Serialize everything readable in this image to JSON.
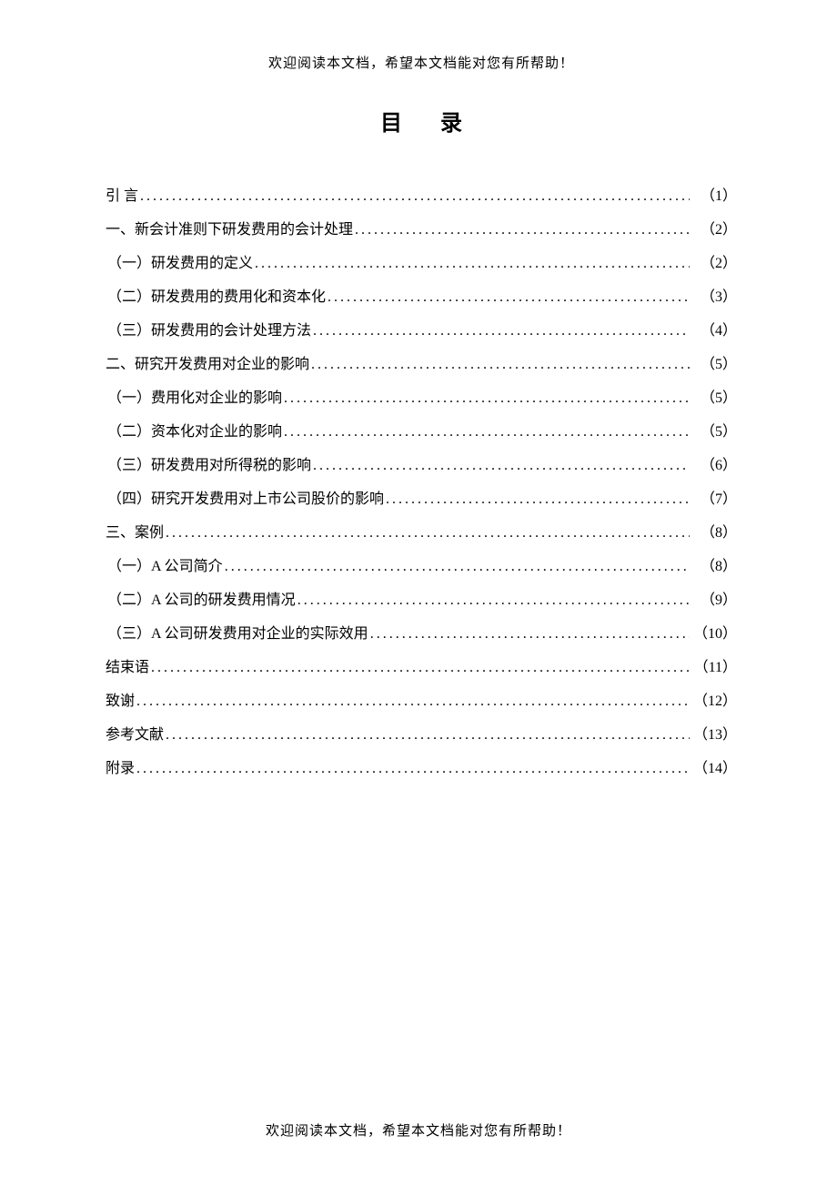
{
  "header_note": "欢迎阅读本文档，希望本文档能对您有所帮助！",
  "footer_note": "欢迎阅读本文档，希望本文档能对您有所帮助！",
  "title": "目  录",
  "toc": [
    {
      "label": "引    言",
      "page": "（1）",
      "level": 0
    },
    {
      "label": "一、新会计准则下研发费用的会计处理",
      "page": "（2）",
      "level": 0
    },
    {
      "label": "（一）研发费用的定义",
      "page": "（2）",
      "level": 1
    },
    {
      "label": "（二）研发费用的费用化和资本化",
      "page": "（3）",
      "level": 1
    },
    {
      "label": "（三）研发费用的会计处理方法",
      "page": "（4）",
      "level": 1
    },
    {
      "label": "二、研究开发费用对企业的影响",
      "page": "（5）",
      "level": 0
    },
    {
      "label": "（一）费用化对企业的影响",
      "page": "（5）",
      "level": 1
    },
    {
      "label": "（二）资本化对企业的影响",
      "page": "（5）",
      "level": 1
    },
    {
      "label": "（三）研发费用对所得税的影响",
      "page": "（6）",
      "level": 1
    },
    {
      "label": "（四）研究开发费用对上市公司股价的影响",
      "page": "（7）",
      "level": 1
    },
    {
      "label": "三、案例",
      "page": "（8）",
      "level": 0
    },
    {
      "label": "（一）A 公司简介",
      "page": "（8）",
      "level": 1
    },
    {
      "label": "（二）A 公司的研发费用情况",
      "page": "（9）",
      "level": 1
    },
    {
      "label": "（三）A 公司研发费用对企业的实际效用",
      "page": "（10）",
      "level": 1
    },
    {
      "label": "结束语",
      "page": "（11）",
      "level": 0
    },
    {
      "label": "致谢",
      "page": "（12）",
      "level": 0
    },
    {
      "label": "参考文献",
      "page": "（13）",
      "level": 0
    },
    {
      "label": "附录",
      "page": "（14）",
      "level": 0
    }
  ]
}
